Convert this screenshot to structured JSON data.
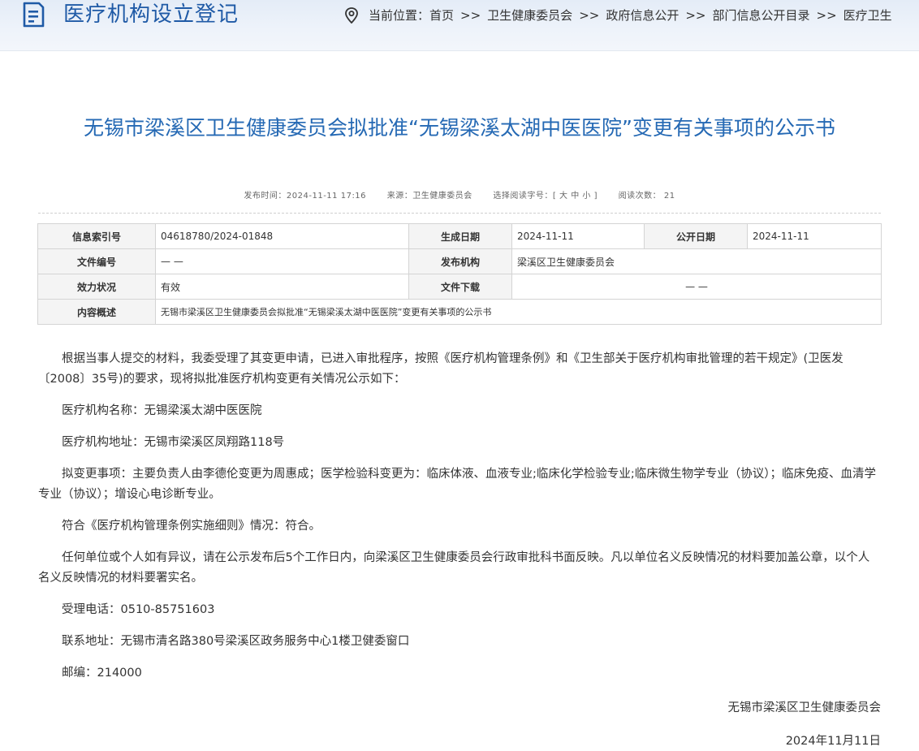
{
  "header": {
    "site_title": "医疗机构设立登记",
    "location_label": "当前位置：",
    "separator": ">>",
    "breadcrumb": [
      "首页",
      "卫生健康委员会",
      "政府信息公开",
      "部门信息公开目录",
      "医疗卫生"
    ]
  },
  "article": {
    "title": "无锡市梁溪区卫生健康委员会拟批准“无锡梁溪太湖中医医院”变更有关事项的公示书",
    "meta": {
      "publish_time": "发布时间：2024-11-11 17:16",
      "source": "来源：卫生健康委员会",
      "font_size_label": "选择阅读字号：[",
      "font_large": "大",
      "font_medium": "中",
      "font_small": "小",
      "font_close": "]",
      "views": "阅读次数： 21"
    },
    "info_table": {
      "index_label": "信息索引号",
      "index_value": "04618780/2024-01848",
      "gen_date_label": "生成日期",
      "gen_date_value": "2024-11-11",
      "pub_date_label": "公开日期",
      "pub_date_value": "2024-11-11",
      "doc_no_label": "文件编号",
      "doc_no_value": "— —",
      "issuer_label": "发布机构",
      "issuer_value": "梁溪区卫生健康委员会",
      "validity_label": "效力状况",
      "validity_value": "有效",
      "download_label": "文件下载",
      "download_value": "— —",
      "summary_label": "内容概述",
      "summary_value": "无锡市梁溪区卫生健康委员会拟批准“无锡梁溪太湖中医医院”变更有关事项的公示书"
    },
    "paragraphs": [
      "根据当事人提交的材料，我委受理了其变更申请，已进入审批程序，按照《医疗机构管理条例》和《卫生部关于医疗机构审批管理的若干规定》(卫医发〔2008〕35号)的要求，现将拟批准医疗机构变更有关情况公示如下：",
      "医疗机构名称：无锡梁溪太湖中医医院",
      "医疗机构地址：无锡市梁溪区凤翔路118号",
      "拟变更事项：主要负责人由李德伦变更为周惠成；医学检验科变更为：临床体液、血液专业;临床化学检验专业;临床微生物学专业（协议）；临床免疫、血清学专业（协议）；增设心电诊断专业。",
      "符合《医疗机构管理条例实施细则》情况：符合。",
      "任何单位或个人如有异议，请在公示发布后5个工作日内，向梁溪区卫生健康委员会行政审批科书面反映。凡以单位名义反映情况的材料要加盖公章，以个人名义反映情况的材料要署实名。",
      "受理电话：0510-85751603",
      "联系地址：无锡市清名路380号梁溪区政务服务中心1楼卫健委窗口",
      "邮编：214000"
    ],
    "signature": "无锡市梁溪区卫生健康委员会",
    "date": "2024年11月11日"
  }
}
